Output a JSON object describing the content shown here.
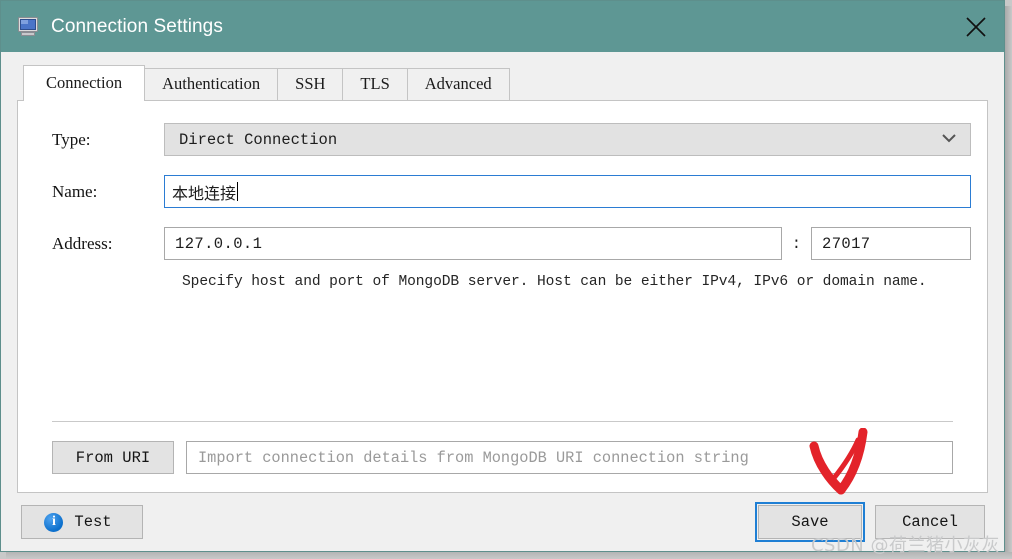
{
  "window": {
    "title": "Connection Settings",
    "icon": "monitor-icon",
    "titlebar_color": "#5e9794",
    "close_icon": "close-icon"
  },
  "tabs": [
    {
      "label": "Connection",
      "active": true
    },
    {
      "label": "Authentication",
      "active": false
    },
    {
      "label": "SSH",
      "active": false
    },
    {
      "label": "TLS",
      "active": false
    },
    {
      "label": "Advanced",
      "active": false
    }
  ],
  "form": {
    "type": {
      "label": "Type:",
      "value": "Direct Connection",
      "chevron": "˅"
    },
    "name": {
      "label": "Name:",
      "value": "本地连接"
    },
    "address": {
      "label": "Address:",
      "host": "127.0.0.1",
      "separator": ":",
      "port": "27017"
    },
    "help_text": "Specify host and port of MongoDB server. Host can be either IPv4, IPv6 or domain name."
  },
  "uri": {
    "button_label": "From URI",
    "placeholder": "Import connection details from MongoDB URI connection string"
  },
  "buttons": {
    "test": {
      "label": "Test",
      "icon": "info-icon",
      "glyph": "i"
    },
    "save": {
      "label": "Save",
      "focus_color": "#1f7fd4"
    },
    "cancel": {
      "label": "Cancel"
    }
  },
  "annotations": {
    "arrow_color": "#e3232a",
    "watermark": "CSDN @荷兰猪小灰灰"
  }
}
